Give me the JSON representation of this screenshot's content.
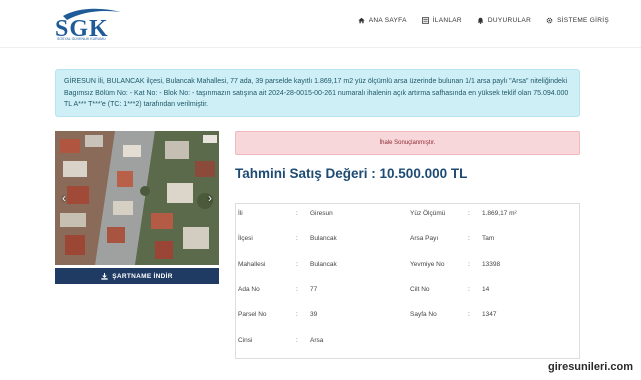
{
  "header": {
    "logo_text": "SGK",
    "logo_sub": "SOSYAL GÜVENLİK KURUMU",
    "nav": [
      {
        "label": "ANA SAYFA",
        "icon": "home-icon"
      },
      {
        "label": "İLANLAR",
        "icon": "list-icon"
      },
      {
        "label": "DUYURULAR",
        "icon": "bell-icon"
      },
      {
        "label": "SİSTEME GİRİŞ",
        "icon": "gear-icon"
      }
    ]
  },
  "info_text": "GİRESUN İli, BULANCAK ilçesi, Bulancak Mahallesi, 77 ada, 39 parselde kayıtlı 1.869,17 m2 yüz ölçümlü arsa üzerinde bulunan 1/1 arsa paylı \"Arsa\" niteliğindeki Bagımsız Bölüm No: - Kat No: - Blok No: - taşınmazın satışına ait 2024-28-0015-00-261 numaralı ihalenin açık artırma safhasında en yüksek teklif olan 75.094.000 TL A*** T***'e (TC: 1***2) tarafından verilmiştir.",
  "download_label": "ŞARTNAME İNDİR",
  "alert_text": "İhale Sonuçlanmıştır.",
  "price_text": "Tahmini Satış Değeri : 10.500.000 TL",
  "details": {
    "left": [
      {
        "label": "İli",
        "value": "Giresun"
      },
      {
        "label": "İlçesi",
        "value": "Bulancak"
      },
      {
        "label": "Mahallesi",
        "value": "Bulancak"
      },
      {
        "label": "Ada No",
        "value": "77"
      },
      {
        "label": "Parsel No",
        "value": "39"
      },
      {
        "label": "Cinsi",
        "value": "Arsa"
      }
    ],
    "right": [
      {
        "label": "Yüz Ölçümü",
        "value": "1.869,17 m²"
      },
      {
        "label": "Arsa Payı",
        "value": "Tam"
      },
      {
        "label": "Yevmiye No",
        "value": "13398"
      },
      {
        "label": "Cilt No",
        "value": "14"
      },
      {
        "label": "Sayfa No",
        "value": "1347"
      }
    ]
  },
  "watermark": "giresunileri.com"
}
